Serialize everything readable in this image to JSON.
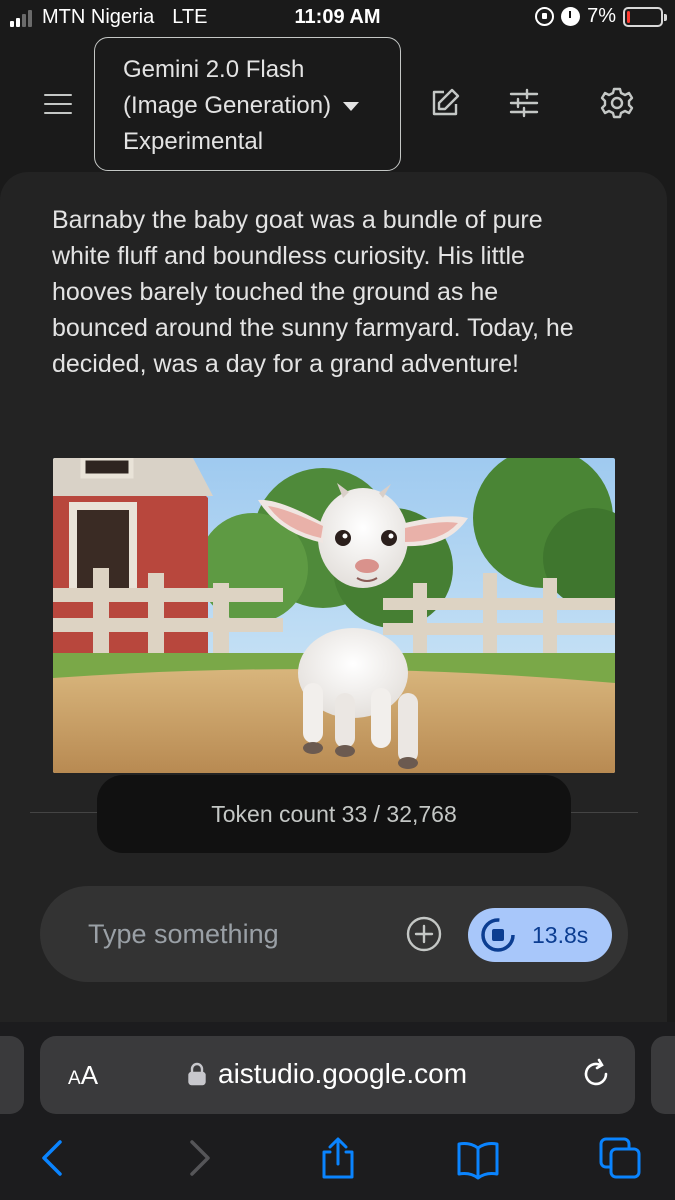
{
  "status_bar": {
    "carrier": "MTN Nigeria",
    "network": "LTE",
    "time": "11:09 AM",
    "battery_percent_label": "7%",
    "battery_level": 0.07,
    "icons": [
      "signal-icon",
      "orientation-lock-icon",
      "alarm-icon",
      "battery-icon"
    ]
  },
  "app_bar": {
    "model_lines": [
      "Gemini 2.0 Flash",
      "(Image Generation)",
      "Experimental"
    ],
    "icons": [
      "menu-icon",
      "edit-icon",
      "tune-icon",
      "settings-icon"
    ]
  },
  "chat": {
    "story_lines": [
      "Barnaby the baby goat was a bundle of pure",
      "white fluff and boundless curiosity. His little",
      "hooves barely touched the ground as he",
      "bounced around the sunny farmyard. Today, he",
      "decided, was a day for a grand adventure!"
    ],
    "token_count": "Token count 33 / 32,768"
  },
  "composer": {
    "placeholder": "Type something",
    "run_timer": "13.8s",
    "icons": [
      "add-circle-icon",
      "stop-icon"
    ]
  },
  "browser": {
    "text_size_label": "AA",
    "url": "aistudio.google.com",
    "icons": [
      "lock-icon",
      "reload-icon",
      "back-icon",
      "forward-icon",
      "share-icon",
      "bookmarks-icon",
      "tabs-icon"
    ]
  },
  "colors": {
    "accent": "#a8c7fa",
    "ios_blue": "#0a84ff",
    "panel": "#232323"
  }
}
